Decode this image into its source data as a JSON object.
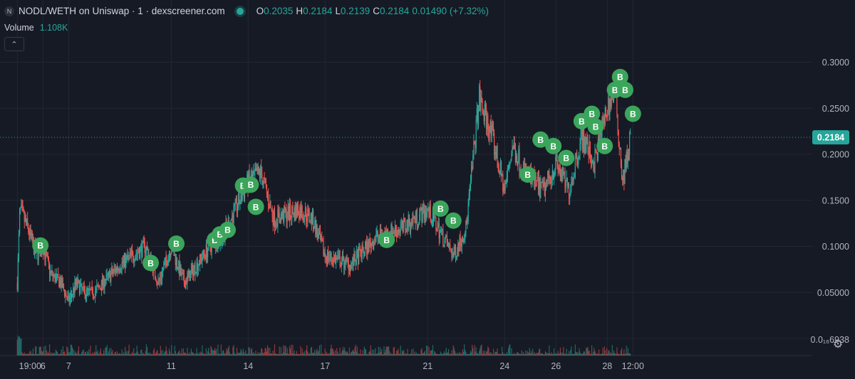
{
  "header": {
    "symbol_icon": "N",
    "title": "NODL/WETH on Uniswap · 1 · dexscreener.com",
    "ohlc": [
      {
        "k": "O",
        "v": "0.2035"
      },
      {
        "k": "H",
        "v": "0.2184"
      },
      {
        "k": "L",
        "v": "0.2139"
      },
      {
        "k": "C",
        "v": "0.2184"
      }
    ],
    "change": "0.01490 (+7.32%)"
  },
  "volume": {
    "label": "Volume",
    "value": "1.108K"
  },
  "controls": {
    "collapse_icon": "chevron-up-icon",
    "settings_icon": "gear-icon"
  },
  "colors": {
    "background": "#161a25",
    "up": "#26a69a",
    "down": "#ef5350",
    "marker": "#3ba55c",
    "price_tag": "#26a69a"
  },
  "chart_data": {
    "type": "candlestick",
    "y_ticks": [
      "0.3000",
      "0.2500",
      "0.2000",
      "0.1500",
      "0.1000",
      "0.05000",
      "0.0₁₆6938"
    ],
    "y_tick_values": [
      0.3,
      0.25,
      0.2,
      0.15,
      0.1,
      0.05,
      0.0
    ],
    "x_ticks": [
      "19:00",
      "6",
      "7",
      "11",
      "14",
      "17",
      "21",
      "24",
      "26",
      "28",
      "12:00"
    ],
    "x_tick_days": [
      5.0,
      6.0,
      7.0,
      11.0,
      14.0,
      17.0,
      21.0,
      24.0,
      26.0,
      28.0,
      29.0
    ],
    "ylim": [
      0,
      0.3
    ],
    "last_price": "0.2184",
    "marker_label": "B",
    "price_path": [
      {
        "d": 5.0,
        "p": 0.06
      },
      {
        "d": 5.1,
        "p": 0.14
      },
      {
        "d": 5.4,
        "p": 0.12
      },
      {
        "d": 5.75,
        "p": 0.09
      },
      {
        "d": 6.0,
        "p": 0.1
      },
      {
        "d": 6.3,
        "p": 0.07
      },
      {
        "d": 6.7,
        "p": 0.06
      },
      {
        "d": 7.0,
        "p": 0.04
      },
      {
        "d": 7.3,
        "p": 0.06
      },
      {
        "d": 7.6,
        "p": 0.05
      },
      {
        "d": 8.0,
        "p": 0.05
      },
      {
        "d": 9.0,
        "p": 0.08
      },
      {
        "d": 10.0,
        "p": 0.1
      },
      {
        "d": 10.5,
        "p": 0.06
      },
      {
        "d": 11.0,
        "p": 0.1
      },
      {
        "d": 11.5,
        "p": 0.06
      },
      {
        "d": 12.0,
        "p": 0.08
      },
      {
        "d": 12.5,
        "p": 0.1
      },
      {
        "d": 13.0,
        "p": 0.11
      },
      {
        "d": 13.5,
        "p": 0.14
      },
      {
        "d": 14.0,
        "p": 0.17
      },
      {
        "d": 14.5,
        "p": 0.18
      },
      {
        "d": 15.0,
        "p": 0.13
      },
      {
        "d": 16.0,
        "p": 0.14
      },
      {
        "d": 16.5,
        "p": 0.13
      },
      {
        "d": 17.0,
        "p": 0.09
      },
      {
        "d": 18.0,
        "p": 0.08
      },
      {
        "d": 19.0,
        "p": 0.11
      },
      {
        "d": 20.0,
        "p": 0.12
      },
      {
        "d": 21.0,
        "p": 0.14
      },
      {
        "d": 22.0,
        "p": 0.09
      },
      {
        "d": 22.5,
        "p": 0.12
      },
      {
        "d": 23.0,
        "p": 0.26
      },
      {
        "d": 23.5,
        "p": 0.22
      },
      {
        "d": 24.0,
        "p": 0.16
      },
      {
        "d": 24.3,
        "p": 0.21
      },
      {
        "d": 24.8,
        "p": 0.18
      },
      {
        "d": 25.5,
        "p": 0.16
      },
      {
        "d": 26.0,
        "p": 0.19
      },
      {
        "d": 26.5,
        "p": 0.16
      },
      {
        "d": 27.0,
        "p": 0.22
      },
      {
        "d": 27.5,
        "p": 0.19
      },
      {
        "d": 28.0,
        "p": 0.25
      },
      {
        "d": 28.3,
        "p": 0.27
      },
      {
        "d": 28.6,
        "p": 0.17
      },
      {
        "d": 28.9,
        "p": 0.2184
      }
    ],
    "markers": [
      {
        "d": 5.9,
        "p": 0.101
      },
      {
        "d": 10.2,
        "p": 0.082
      },
      {
        "d": 11.2,
        "p": 0.103
      },
      {
        "d": 12.7,
        "p": 0.107
      },
      {
        "d": 12.9,
        "p": 0.113
      },
      {
        "d": 13.2,
        "p": 0.118
      },
      {
        "d": 13.8,
        "p": 0.166
      },
      {
        "d": 14.1,
        "p": 0.167
      },
      {
        "d": 14.3,
        "p": 0.143
      },
      {
        "d": 19.4,
        "p": 0.107
      },
      {
        "d": 21.5,
        "p": 0.141
      },
      {
        "d": 22.0,
        "p": 0.128
      },
      {
        "d": 24.9,
        "p": 0.178
      },
      {
        "d": 25.4,
        "p": 0.216
      },
      {
        "d": 25.9,
        "p": 0.209
      },
      {
        "d": 26.4,
        "p": 0.196
      },
      {
        "d": 27.0,
        "p": 0.236
      },
      {
        "d": 27.4,
        "p": 0.244
      },
      {
        "d": 27.55,
        "p": 0.23
      },
      {
        "d": 27.9,
        "p": 0.209
      },
      {
        "d": 28.3,
        "p": 0.27
      },
      {
        "d": 28.5,
        "p": 0.284
      },
      {
        "d": 28.7,
        "p": 0.27
      },
      {
        "d": 29.0,
        "p": 0.244
      }
    ]
  }
}
